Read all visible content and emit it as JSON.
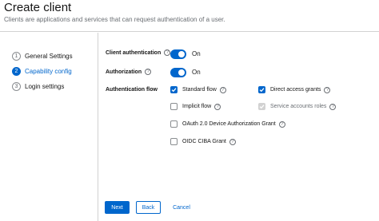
{
  "header": {
    "title": "Create client",
    "subtitle": "Clients are applications and services that can request authentication of a user."
  },
  "wizard": {
    "steps": [
      {
        "number": "1",
        "label": "General Settings",
        "current": false
      },
      {
        "number": "2",
        "label": "Capability config",
        "current": true
      },
      {
        "number": "3",
        "label": "Login settings",
        "current": false
      }
    ]
  },
  "form": {
    "client_authentication": {
      "label": "Client authentication",
      "state": "On",
      "enabled": true
    },
    "authorization": {
      "label": "Authorization",
      "state": "On",
      "enabled": true
    },
    "authentication_flow": {
      "label": "Authentication flow",
      "options": {
        "standard_flow": {
          "label": "Standard flow",
          "checked": true,
          "disabled": false
        },
        "direct_access_grants": {
          "label": "Direct access grants",
          "checked": true,
          "disabled": false
        },
        "implicit_flow": {
          "label": "Implicit flow",
          "checked": false,
          "disabled": false
        },
        "service_accounts_roles": {
          "label": "Service accounts roles",
          "checked": true,
          "disabled": true
        },
        "oauth_device_grant": {
          "label": "OAuth 2.0 Device Authorization Grant",
          "checked": false,
          "disabled": false
        },
        "oidc_ciba_grant": {
          "label": "OIDC CIBA Grant",
          "checked": false,
          "disabled": false
        }
      }
    }
  },
  "footer": {
    "next_label": "Next",
    "back_label": "Back",
    "cancel_label": "Cancel"
  },
  "icons": {
    "help": "question-circle-icon",
    "check": "checkmark-icon"
  },
  "colors": {
    "primary": "#0066cc",
    "disabled_check": "#d2d2d2",
    "border": "#d2d2d2",
    "muted_text": "#6a6e73"
  }
}
